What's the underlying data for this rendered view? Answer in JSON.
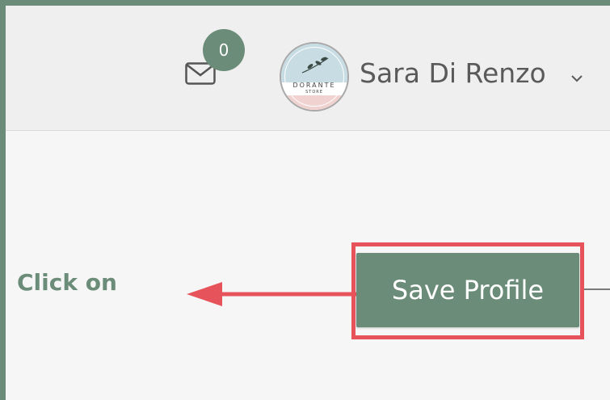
{
  "colors": {
    "accent": "#6b8c78",
    "highlight": "#e6535a",
    "header_bg": "#efefef"
  },
  "header": {
    "mail_icon": "envelope-icon",
    "notification_count": "0",
    "avatar_brand": "DORANTE",
    "avatar_brand_sub": "STORE",
    "user_name": "Sara Di Renzo",
    "dropdown_icon": "chevron-down-icon"
  },
  "annotation": {
    "instruction": "Click on",
    "arrow_icon": "arrow-left-icon"
  },
  "actions": {
    "save_label": "Save Profile"
  }
}
